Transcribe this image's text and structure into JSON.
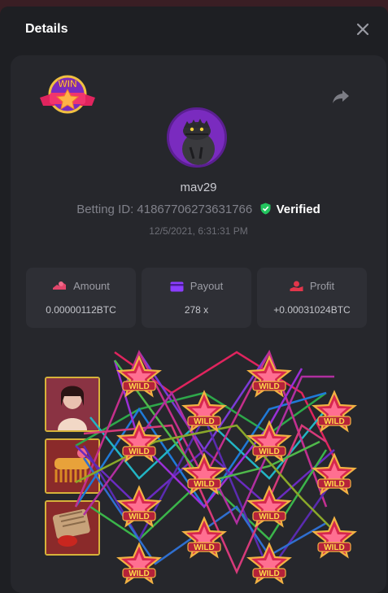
{
  "modal": {
    "title": "Details"
  },
  "badge": {
    "text": "WIN"
  },
  "player": {
    "username": "mav29",
    "betting_id_label": "Betting ID: 418677062736317​66",
    "verified_label": "Verified",
    "timestamp": "12/5/2021, 6:31:31 PM"
  },
  "stats": {
    "amount": {
      "label": "Amount",
      "value": "0.00000112BTC"
    },
    "payout": {
      "label": "Payout",
      "value": "278 x"
    },
    "profit": {
      "label": "Profit",
      "value": "+0.00031024BTC"
    }
  },
  "colors": {
    "accent_green": "#22c55e",
    "amount_icon": "#e2466b",
    "payout_icon": "#8b3dff",
    "profit_icon": "#e2364b"
  },
  "icons": {
    "close": "close-icon",
    "share": "share-icon",
    "verified": "shield-check-icon"
  }
}
